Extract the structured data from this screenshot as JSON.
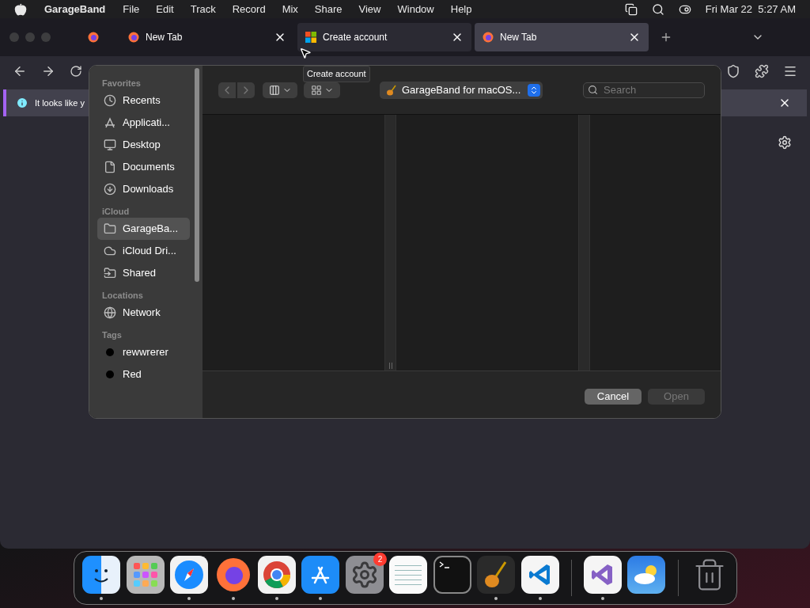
{
  "menu_bar": {
    "app": "GarageBand",
    "items": [
      "File",
      "Edit",
      "Track",
      "Record",
      "Mix",
      "Share",
      "View",
      "Window",
      "Help"
    ],
    "clock": "Fri Mar 22  5:27 AM"
  },
  "browser": {
    "tabs": [
      {
        "label": "New Tab",
        "kind": "firefox",
        "selected": false
      },
      {
        "label": "Create account",
        "kind": "microsoft",
        "selected": false
      },
      {
        "label": "New Tab",
        "kind": "firefox",
        "selected": true
      }
    ],
    "tooltip": "Create account",
    "notification": "It looks like y"
  },
  "dialog": {
    "location": "GarageBand for macOS...",
    "search": {
      "placeholder": "Search"
    },
    "sidebar": [
      {
        "heading": "Favorites",
        "items": [
          {
            "label": "Recents",
            "kind": "clock",
            "selected": false
          },
          {
            "label": "Applicati...",
            "kind": "apps",
            "selected": false
          },
          {
            "label": "Desktop",
            "kind": "desktop",
            "selected": false
          },
          {
            "label": "Documents",
            "kind": "doc",
            "selected": false
          },
          {
            "label": "Downloads",
            "kind": "download",
            "selected": false
          }
        ]
      },
      {
        "heading": "iCloud",
        "items": [
          {
            "label": "GarageBa...",
            "kind": "folder",
            "selected": true
          },
          {
            "label": "iCloud Dri...",
            "kind": "cloud",
            "selected": false
          },
          {
            "label": "Shared",
            "kind": "shared",
            "selected": false
          }
        ]
      },
      {
        "heading": "Locations",
        "items": [
          {
            "label": "Network",
            "kind": "network",
            "selected": false
          }
        ]
      },
      {
        "heading": "Tags",
        "items": [
          {
            "label": "rewwrerer",
            "kind": "tag",
            "color": "#000000",
            "selected": false
          },
          {
            "label": "Red",
            "kind": "tag",
            "color": "#000000",
            "selected": false
          }
        ]
      }
    ],
    "buttons": [
      {
        "label": "Cancel",
        "disabled": false
      },
      {
        "label": "Open",
        "disabled": true
      }
    ]
  },
  "dock": [
    {
      "kind": "finder",
      "running": true
    },
    {
      "kind": "launchpad",
      "running": false
    },
    {
      "kind": "safari",
      "running": true
    },
    {
      "kind": "firefox",
      "running": true
    },
    {
      "kind": "chrome",
      "running": true
    },
    {
      "kind": "appstore",
      "running": true
    },
    {
      "kind": "settings",
      "running": false,
      "badge": "2"
    },
    {
      "kind": "textedit",
      "running": false
    },
    {
      "kind": "terminal",
      "running": false
    },
    {
      "kind": "garageband",
      "running": true
    },
    {
      "kind": "vscode",
      "running": true
    },
    {
      "kind": "separator"
    },
    {
      "kind": "visualstudio",
      "running": true
    },
    {
      "kind": "weather",
      "running": false
    },
    {
      "kind": "separator"
    },
    {
      "kind": "trash",
      "running": false
    }
  ]
}
